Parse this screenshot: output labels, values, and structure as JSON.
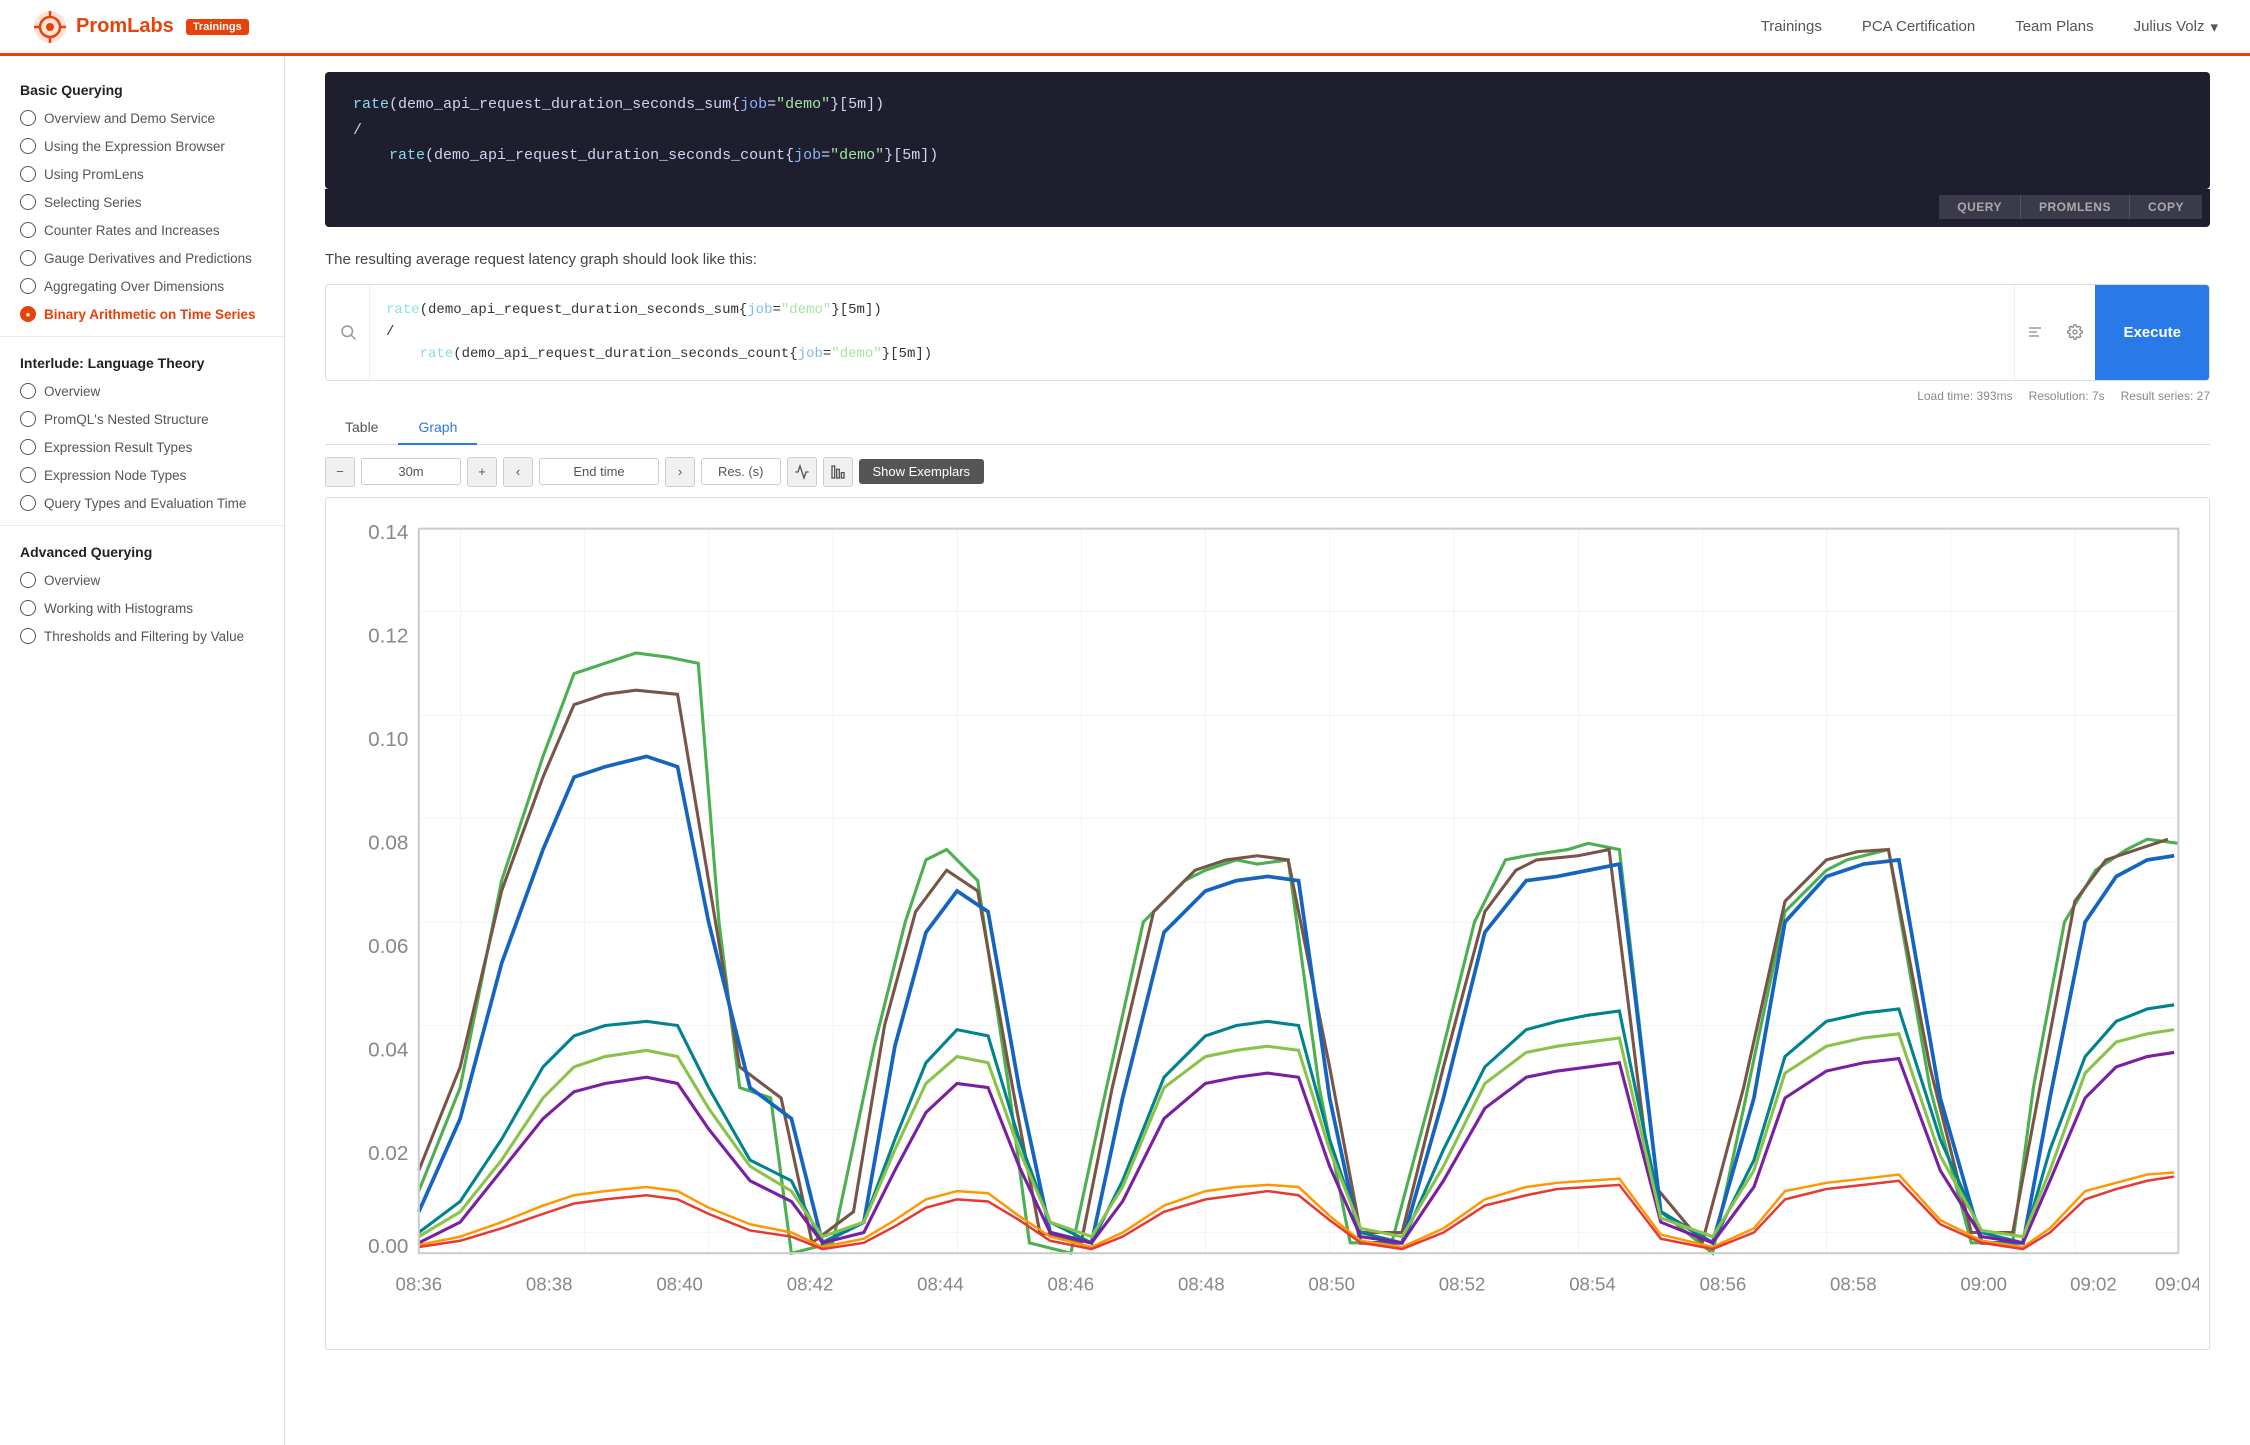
{
  "header": {
    "logo_text": "PromLabs",
    "badge": "Trainings",
    "nav": [
      "Trainings",
      "PCA Certification",
      "Team Plans"
    ],
    "user": "Julius Volz"
  },
  "sidebar": {
    "sections": [
      {
        "title": "Basic Querying",
        "items": [
          {
            "label": "Overview and Demo Service",
            "active": false
          },
          {
            "label": "Using the Expression Browser",
            "active": false
          },
          {
            "label": "Using PromLens",
            "active": false
          },
          {
            "label": "Selecting Series",
            "active": false
          },
          {
            "label": "Counter Rates and Increases",
            "active": false
          },
          {
            "label": "Gauge Derivatives and Predictions",
            "active": false
          },
          {
            "label": "Aggregating Over Dimensions",
            "active": false
          },
          {
            "label": "Binary Arithmetic on Time Series",
            "active": true
          }
        ]
      },
      {
        "title": "Interlude: Language Theory",
        "items": [
          {
            "label": "Overview",
            "active": false
          },
          {
            "label": "PromQL's Nested Structure",
            "active": false
          },
          {
            "label": "Expression Result Types",
            "active": false
          },
          {
            "label": "Expression Node Types",
            "active": false
          },
          {
            "label": "Query Types and Evaluation Time",
            "active": false
          }
        ]
      },
      {
        "title": "Advanced Querying",
        "items": [
          {
            "label": "Overview",
            "active": false
          },
          {
            "label": "Working with Histograms",
            "active": false
          },
          {
            "label": "Thresholds and Filtering by Value",
            "active": false
          }
        ]
      }
    ]
  },
  "code_block": {
    "line1": "rate(demo_api_request_duration_seconds_sum{job=\"demo\"}[5m])",
    "line2": "/",
    "line3": "rate(demo_api_request_duration_seconds_count{job=\"demo\"}[5m])",
    "buttons": [
      "QUERY",
      "PROMLENS",
      "COPY"
    ]
  },
  "description": "The resulting average request latency graph should look like this:",
  "query_box": {
    "line1": "rate(demo_api_request_duration_seconds_sum{job=\"demo\"}[5m])",
    "line2": "/",
    "line3": "rate(demo_api_request_duration_seconds_count{job=\"demo\"}[5m])",
    "execute_label": "Execute"
  },
  "meta": {
    "load_time": "Load time: 393ms",
    "resolution": "Resolution: 7s",
    "result_series": "Result series: 27"
  },
  "tabs": [
    "Table",
    "Graph"
  ],
  "active_tab": "Graph",
  "graph_controls": {
    "minus": "-",
    "duration": "30m",
    "plus": "+",
    "prev": "<",
    "end_time_placeholder": "End time",
    "next": ">",
    "res_label": "Res. (s)",
    "show_exemplars": "Show Exemplars"
  },
  "chart": {
    "y_labels": [
      "0.14",
      "0.12",
      "0.10",
      "0.08",
      "0.06",
      "0.04",
      "0.02",
      "0.00"
    ],
    "x_labels": [
      "08:36",
      "08:38",
      "08:40",
      "08:42",
      "08:44",
      "08:46",
      "08:48",
      "08:50",
      "08:52",
      "08:54",
      "08:56",
      "08:58",
      "09:00",
      "09:02",
      "09:04"
    ]
  }
}
